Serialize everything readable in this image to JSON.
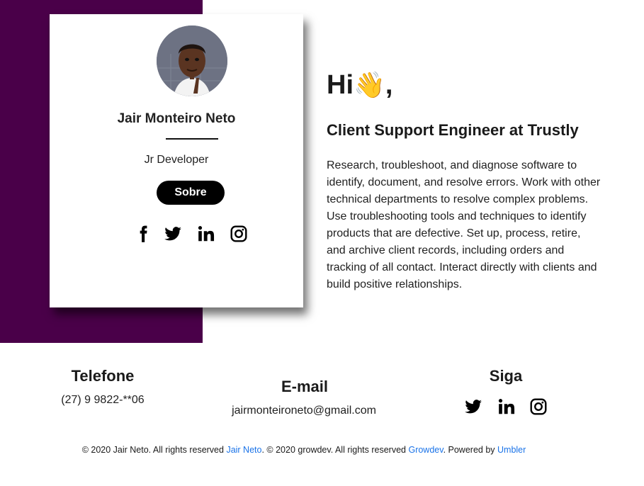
{
  "profile": {
    "name": "Jair Monteiro Neto",
    "role": "Jr Developer",
    "about_button": "Sobre",
    "social_icons": [
      "facebook-icon",
      "twitter-icon",
      "linkedin-icon",
      "instagram-icon"
    ]
  },
  "intro": {
    "greeting": "Hi",
    "wave_emoji": "👋",
    "greeting_suffix": ",",
    "title": "Client Support Engineer at Trustly",
    "bio": "Research, troubleshoot, and diagnose software to identify, document, and resolve errors. Work with other technical departments to resolve complex problems. Use troubleshooting tools and techniques to identify products that are defective. Set up, process, retire, and archive client records, including orders and tracking of all contact. Interact directly with clients and build positive relationships."
  },
  "contact": {
    "phone_heading": "Telefone",
    "phone_value": "(27) 9 9822-**06",
    "email_heading": "E-mail",
    "email_value": "jairmonteironeto@gmail.com",
    "follow_heading": "Siga",
    "follow_icons": [
      "twitter-icon",
      "linkedin-icon",
      "instagram-icon"
    ]
  },
  "footer": {
    "text_1": "© 2020 Jair Neto. All rights reserved ",
    "link_1": "Jair Neto",
    "text_2": ". © 2020 growdev. All rights reserved ",
    "link_2": "Growdev",
    "text_3": ". Powered by ",
    "link_3": "Umbler"
  },
  "colors": {
    "accent_band": "#4a0049",
    "button_bg": "#000000",
    "link": "#1a73e8"
  }
}
